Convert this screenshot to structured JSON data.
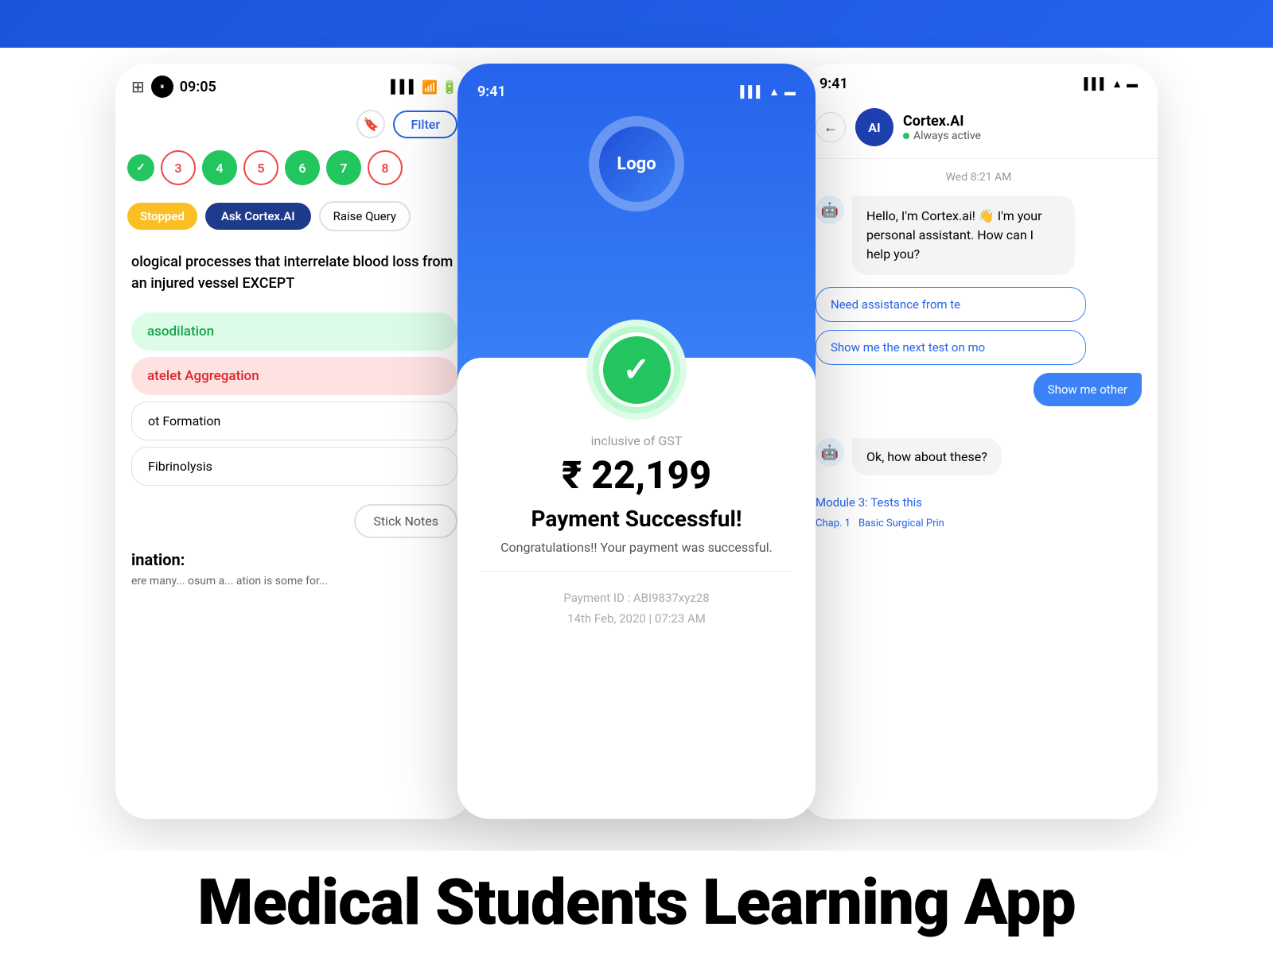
{
  "banner": {
    "bg": "#2563eb"
  },
  "phone1": {
    "time": "09:05",
    "filter_label": "Filter",
    "stopped_label": "Stopped",
    "ask_cortex_label": "Ask Cortex.AI",
    "raise_query_label": "Raise Query",
    "question_text": "ological processes that interrelate blood loss from an injured vessel EXCEPT",
    "option1": "asodilation",
    "option2": "atelet Aggregation",
    "option3": "ot Formation",
    "option4": "Fibrinolysis",
    "info_label": "ination:",
    "info_text": "ere many... osum a... ation is some for...",
    "stick_notes_label": "Stick Notes",
    "q_numbers": [
      "3",
      "4",
      "5",
      "6",
      "7",
      "8"
    ]
  },
  "phone2": {
    "time": "9:41",
    "logo_label": "Logo",
    "gst_label": "inclusive of GST",
    "amount": "₹ 22,199",
    "success_title": "Payment Successful!",
    "success_desc": "Congratulations!! Your payment was successful.",
    "payment_id": "Payment ID : ABI9837xyz28",
    "payment_date": "14th Feb, 2020 | 07:23 AM"
  },
  "phone3": {
    "time": "9:41",
    "ai_name": "Cortex.AI",
    "ai_status": "Always active",
    "timestamp": "Wed 8:21 AM",
    "greeting": "Hello, I'm Cortex.ai! 👋 I'm your personal assistant. How can I help you?",
    "msg1": "Need assistance from te",
    "msg2": "Show me the next test on mo",
    "msg3": "Show me other",
    "response1": "Ok, how about these?",
    "module_link": "Module 3: Tests this",
    "chap_label": "Chap. 1",
    "chap_name": "Basic Surgical Prin"
  },
  "bottom_title": "Medical Students Learning App"
}
